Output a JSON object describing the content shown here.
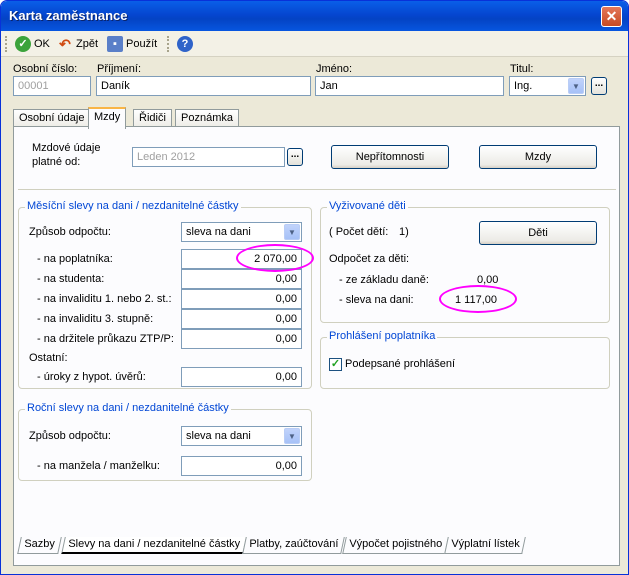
{
  "window": {
    "title": "Karta zaměstnance"
  },
  "toolbar": {
    "ok": "OK",
    "back": "Zpět",
    "apply": "Použít",
    "help": "?"
  },
  "header": {
    "osobni_cislo_label": "Osobní číslo:",
    "osobni_cislo": "00001",
    "prijmeni_label": "Příjmení:",
    "prijmeni": "Daník",
    "jmeno_label": "Jméno:",
    "jmeno": "Jan",
    "titul_label": "Titul:",
    "titul": "Ing."
  },
  "tabs": [
    "Osobní údaje",
    "Mzdy",
    "Řidiči",
    "Poznámka"
  ],
  "mzdy": {
    "platne_label_1": "Mzdové údaje",
    "platne_label_2": "platné od:",
    "platne_od": "Leden 2012",
    "nepritomnosti_button": "Nepřítomnosti",
    "mzdy_button": "Mzdy"
  },
  "mesicni": {
    "title": "Měsíční slevy na dani / nezdanitelné částky",
    "zpusob_label": "Způsob odpočtu:",
    "zpusob_value": "sleva na dani",
    "rows": [
      {
        "label": "- na poplatníka:",
        "value": "2 070,00"
      },
      {
        "label": "- na studenta:",
        "value": "0,00"
      },
      {
        "label": "- na invaliditu 1. nebo 2. st.:",
        "value": "0,00"
      },
      {
        "label": "- na invaliditu 3. stupně:",
        "value": "0,00"
      },
      {
        "label": "- na držitele průkazu ZTP/P:",
        "value": "0,00"
      }
    ],
    "ostatni_label": "Ostatní:",
    "uroky_label": "- úroky z hypot. úvěrů:",
    "uroky_value": "0,00"
  },
  "rocni": {
    "title": "Roční slevy na dani / nezdanitelné částky",
    "zpusob_label": "Způsob odpočtu:",
    "zpusob_value": "sleva na dani",
    "manzel_label": "- na manžela / manželku:",
    "manzel_value": "0,00"
  },
  "deti": {
    "title": "Vyživované děti",
    "pocet_label": "( Počet dětí:",
    "pocet_value": "1)",
    "deti_button": "Děti",
    "odpocet_label": "Odpočet za děti:",
    "ze_zakladu_label": "- ze základu daně:",
    "ze_zakladu_value": "0,00",
    "sleva_label": "- sleva na dani:",
    "sleva_value": "1 117,00"
  },
  "prohlaseni": {
    "title": "Prohlášení poplatníka",
    "checkbox_label": "Podepsané prohlášení",
    "checked": true
  },
  "bottom_tabs": [
    "Sazby",
    "Slevy na dani / nezdanitelné částky",
    "Platby, zaúčtování",
    "Výpočet pojistného",
    "Výplatní lístek"
  ],
  "colors": {
    "title_bar": "#0546d0",
    "highlight": "#ff00ff",
    "group_title": "#0046d5"
  }
}
